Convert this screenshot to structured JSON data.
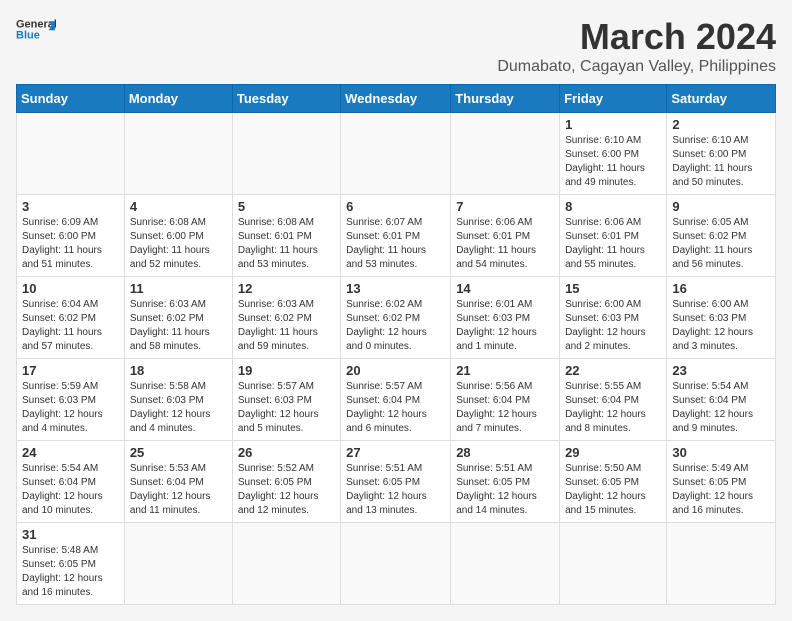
{
  "header": {
    "logo_line1": "General",
    "logo_line2": "Blue",
    "month_title": "March 2024",
    "subtitle": "Dumabato, Cagayan Valley, Philippines"
  },
  "days_of_week": [
    "Sunday",
    "Monday",
    "Tuesday",
    "Wednesday",
    "Thursday",
    "Friday",
    "Saturday"
  ],
  "weeks": [
    [
      {
        "day": "",
        "info": ""
      },
      {
        "day": "",
        "info": ""
      },
      {
        "day": "",
        "info": ""
      },
      {
        "day": "",
        "info": ""
      },
      {
        "day": "",
        "info": ""
      },
      {
        "day": "1",
        "info": "Sunrise: 6:10 AM\nSunset: 6:00 PM\nDaylight: 11 hours and 49 minutes."
      },
      {
        "day": "2",
        "info": "Sunrise: 6:10 AM\nSunset: 6:00 PM\nDaylight: 11 hours and 50 minutes."
      }
    ],
    [
      {
        "day": "3",
        "info": "Sunrise: 6:09 AM\nSunset: 6:00 PM\nDaylight: 11 hours and 51 minutes."
      },
      {
        "day": "4",
        "info": "Sunrise: 6:08 AM\nSunset: 6:00 PM\nDaylight: 11 hours and 52 minutes."
      },
      {
        "day": "5",
        "info": "Sunrise: 6:08 AM\nSunset: 6:01 PM\nDaylight: 11 hours and 53 minutes."
      },
      {
        "day": "6",
        "info": "Sunrise: 6:07 AM\nSunset: 6:01 PM\nDaylight: 11 hours and 53 minutes."
      },
      {
        "day": "7",
        "info": "Sunrise: 6:06 AM\nSunset: 6:01 PM\nDaylight: 11 hours and 54 minutes."
      },
      {
        "day": "8",
        "info": "Sunrise: 6:06 AM\nSunset: 6:01 PM\nDaylight: 11 hours and 55 minutes."
      },
      {
        "day": "9",
        "info": "Sunrise: 6:05 AM\nSunset: 6:02 PM\nDaylight: 11 hours and 56 minutes."
      }
    ],
    [
      {
        "day": "10",
        "info": "Sunrise: 6:04 AM\nSunset: 6:02 PM\nDaylight: 11 hours and 57 minutes."
      },
      {
        "day": "11",
        "info": "Sunrise: 6:03 AM\nSunset: 6:02 PM\nDaylight: 11 hours and 58 minutes."
      },
      {
        "day": "12",
        "info": "Sunrise: 6:03 AM\nSunset: 6:02 PM\nDaylight: 11 hours and 59 minutes."
      },
      {
        "day": "13",
        "info": "Sunrise: 6:02 AM\nSunset: 6:02 PM\nDaylight: 12 hours and 0 minutes."
      },
      {
        "day": "14",
        "info": "Sunrise: 6:01 AM\nSunset: 6:03 PM\nDaylight: 12 hours and 1 minute."
      },
      {
        "day": "15",
        "info": "Sunrise: 6:00 AM\nSunset: 6:03 PM\nDaylight: 12 hours and 2 minutes."
      },
      {
        "day": "16",
        "info": "Sunrise: 6:00 AM\nSunset: 6:03 PM\nDaylight: 12 hours and 3 minutes."
      }
    ],
    [
      {
        "day": "17",
        "info": "Sunrise: 5:59 AM\nSunset: 6:03 PM\nDaylight: 12 hours and 4 minutes."
      },
      {
        "day": "18",
        "info": "Sunrise: 5:58 AM\nSunset: 6:03 PM\nDaylight: 12 hours and 4 minutes."
      },
      {
        "day": "19",
        "info": "Sunrise: 5:57 AM\nSunset: 6:03 PM\nDaylight: 12 hours and 5 minutes."
      },
      {
        "day": "20",
        "info": "Sunrise: 5:57 AM\nSunset: 6:04 PM\nDaylight: 12 hours and 6 minutes."
      },
      {
        "day": "21",
        "info": "Sunrise: 5:56 AM\nSunset: 6:04 PM\nDaylight: 12 hours and 7 minutes."
      },
      {
        "day": "22",
        "info": "Sunrise: 5:55 AM\nSunset: 6:04 PM\nDaylight: 12 hours and 8 minutes."
      },
      {
        "day": "23",
        "info": "Sunrise: 5:54 AM\nSunset: 6:04 PM\nDaylight: 12 hours and 9 minutes."
      }
    ],
    [
      {
        "day": "24",
        "info": "Sunrise: 5:54 AM\nSunset: 6:04 PM\nDaylight: 12 hours and 10 minutes."
      },
      {
        "day": "25",
        "info": "Sunrise: 5:53 AM\nSunset: 6:04 PM\nDaylight: 12 hours and 11 minutes."
      },
      {
        "day": "26",
        "info": "Sunrise: 5:52 AM\nSunset: 6:05 PM\nDaylight: 12 hours and 12 minutes."
      },
      {
        "day": "27",
        "info": "Sunrise: 5:51 AM\nSunset: 6:05 PM\nDaylight: 12 hours and 13 minutes."
      },
      {
        "day": "28",
        "info": "Sunrise: 5:51 AM\nSunset: 6:05 PM\nDaylight: 12 hours and 14 minutes."
      },
      {
        "day": "29",
        "info": "Sunrise: 5:50 AM\nSunset: 6:05 PM\nDaylight: 12 hours and 15 minutes."
      },
      {
        "day": "30",
        "info": "Sunrise: 5:49 AM\nSunset: 6:05 PM\nDaylight: 12 hours and 16 minutes."
      }
    ],
    [
      {
        "day": "31",
        "info": "Sunrise: 5:48 AM\nSunset: 6:05 PM\nDaylight: 12 hours and 16 minutes."
      },
      {
        "day": "",
        "info": ""
      },
      {
        "day": "",
        "info": ""
      },
      {
        "day": "",
        "info": ""
      },
      {
        "day": "",
        "info": ""
      },
      {
        "day": "",
        "info": ""
      },
      {
        "day": "",
        "info": ""
      }
    ]
  ]
}
